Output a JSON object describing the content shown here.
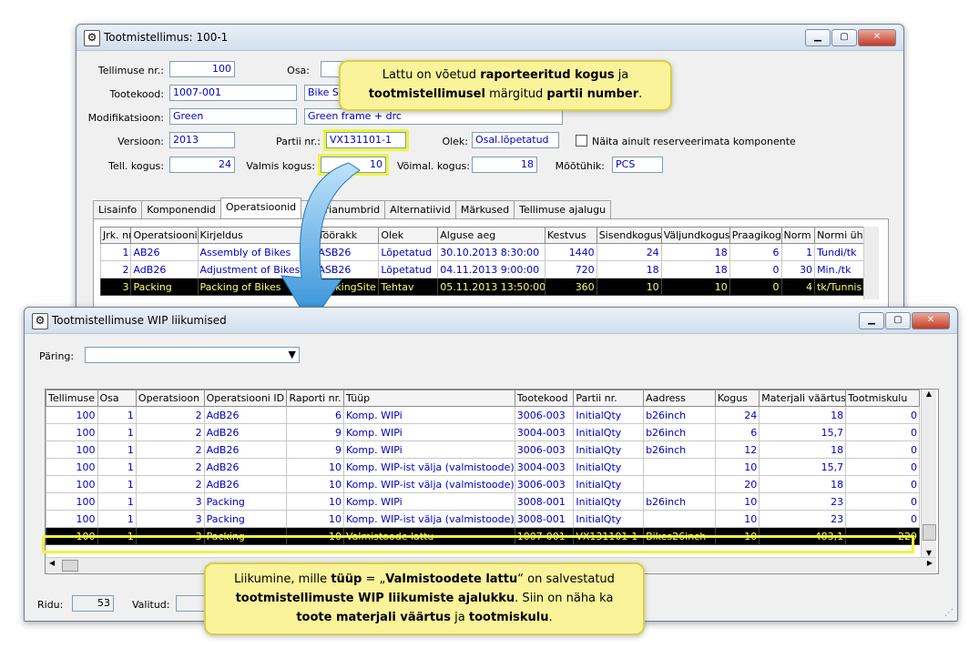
{
  "top_window": {
    "title": "Tootmistellimus: 100-1",
    "fields": {
      "tellimuse_nr_label": "Tellimuse nr.:",
      "tellimuse_nr": "100",
      "osa_label": "Osa:",
      "tootekood_label": "Tootekood:",
      "tootekood": "1007-001",
      "tootekood_desc": "Bike S",
      "modifikatsioon_label": "Modifikatsioon:",
      "modifikatsioon": "Green",
      "modifikatsioon_desc": "Green frame + drc",
      "versioon_label": "Versioon:",
      "versioon": "2013",
      "partii_label": "Partii nr.:",
      "partii": "VX131101-1",
      "olek_label": "Olek:",
      "olek": "Osal.lõpetatud",
      "checkbox_label": "Näita ainult reserveerimata komponente",
      "tell_kogus_label": "Tell. kogus:",
      "tell_kogus": "24",
      "valmis_kogus_label": "Valmis kogus:",
      "valmis_kogus": "10",
      "voimal_kogus_label": "Võimal. kogus:",
      "voimal_kogus": "18",
      "mootuhik_label": "Mõõtühik:",
      "mootuhik": "PCS"
    },
    "tabs": [
      "Lisainfo",
      "Komponendid",
      "Operatsioonid",
      "Seerianumbrid",
      "Alternatiivid",
      "Märkused",
      "Tellimuse ajalugu"
    ],
    "ops_columns": [
      "Jrk. nr",
      "Operatsiooni",
      "Kirjeldus",
      "Töörakk",
      "Olek",
      "Alguse aeg",
      "Kestvus",
      "Sisendkogus",
      "Väljundkogus",
      "Praagikogus",
      "Norm",
      "Normi ühik"
    ],
    "ops_rows": [
      [
        "1",
        "AB26",
        "Assembly of Bikes",
        "ASB26",
        "Lõpetatud",
        "30.10.2013 8:30:00",
        "1440",
        "24",
        "18",
        "6",
        "1",
        "Tundi/tk"
      ],
      [
        "2",
        "AdB26",
        "Adjustment of Bikes",
        "ASB26",
        "Lõpetatud",
        "04.11.2013 9:00:00",
        "720",
        "18",
        "18",
        "0",
        "30",
        "Min./tk"
      ],
      [
        "3",
        "Packing",
        "Packing of Bikes",
        "PackingSite",
        "Tehtav",
        "05.11.2013 13:50:00",
        "360",
        "10",
        "10",
        "0",
        "4",
        "tk/Tunnis"
      ]
    ]
  },
  "wip_window": {
    "title": "Tootmistellimuse WIP liikumised",
    "paring_label": "Päring:",
    "columns": [
      "Tellimuse",
      "Osa",
      "Operatsioon",
      "Operatsiooni ID",
      "Raporti nr.",
      "Tüüp",
      "Tootekood",
      "Partii nr.",
      "Aadress",
      "Kogus",
      "Materjali väärtus",
      "Tootmiskulu"
    ],
    "rows": [
      [
        "100",
        "1",
        "2",
        "AdB26",
        "6",
        "Komp. WIPi",
        "3006-003",
        "InitialQty",
        "b26inch",
        "24",
        "18",
        "0"
      ],
      [
        "100",
        "1",
        "2",
        "AdB26",
        "9",
        "Komp. WIPi",
        "3004-003",
        "InitialQty",
        "b26inch",
        "6",
        "15,7",
        "0"
      ],
      [
        "100",
        "1",
        "2",
        "AdB26",
        "9",
        "Komp. WIPi",
        "3006-003",
        "InitialQty",
        "b26inch",
        "12",
        "18",
        "0"
      ],
      [
        "100",
        "1",
        "2",
        "AdB26",
        "10",
        "Komp. WIP-ist välja (valmistoode)",
        "3004-003",
        "InitialQty",
        "",
        "10",
        "15,7",
        "0"
      ],
      [
        "100",
        "1",
        "2",
        "AdB26",
        "10",
        "Komp. WIP-ist välja (valmistoode)",
        "3006-003",
        "InitialQty",
        "",
        "20",
        "18",
        "0"
      ],
      [
        "100",
        "1",
        "3",
        "Packing",
        "10",
        "Komp. WIPi",
        "3008-001",
        "InitialQty",
        "b26inch",
        "10",
        "23",
        "0"
      ],
      [
        "100",
        "1",
        "3",
        "Packing",
        "10",
        "Komp. WIP-ist välja (valmistoode)",
        "3008-001",
        "InitialQty",
        "",
        "10",
        "23",
        "0"
      ],
      [
        "100",
        "1",
        "3",
        "Packing",
        "10",
        "Valmistoode lattu",
        "1007-001",
        "VX131101-1",
        "Bikes26inch",
        "10",
        "483,1",
        "229"
      ]
    ],
    "status": {
      "ridu_label": "Ridu:",
      "ridu": "53",
      "valitud_label": "Valitud:"
    }
  },
  "callouts": {
    "top_line1_pre": "Lattu on võetud ",
    "top_line1_bold": "raporteeritud kogus",
    "top_line1_post": " ja",
    "top_line2_bold1": "tootmistellimusel",
    "top_line2_mid": " märgitud ",
    "top_line2_bold2": "partii number",
    "top_line2_post": ".",
    "bottom_line1_pre": "Liikumine, mille ",
    "bottom_line1_bold1": "tüüp",
    "bottom_line1_mid": " = „",
    "bottom_line1_bold2": "Valmistoodete lattu",
    "bottom_line1_post": "“ on salvestatud",
    "bottom_line2_bold": "tootmistellimuste WIP liikumiste ajalukku",
    "bottom_line2_post": ". Siin on näha ka",
    "bottom_line3_bold1": "toote materjali väärtus",
    "bottom_line3_mid": " ja ",
    "bottom_line3_bold2": "tootmiskulu",
    "bottom_line3_post": "."
  },
  "colors": {
    "highlight": "#ecf542",
    "callout_bg": "#fbf39a",
    "selected_row_bg": "#000000",
    "selected_row_fg": "#ffff66",
    "link_text": "#0000cc",
    "arrow": "#2f8fd8"
  }
}
